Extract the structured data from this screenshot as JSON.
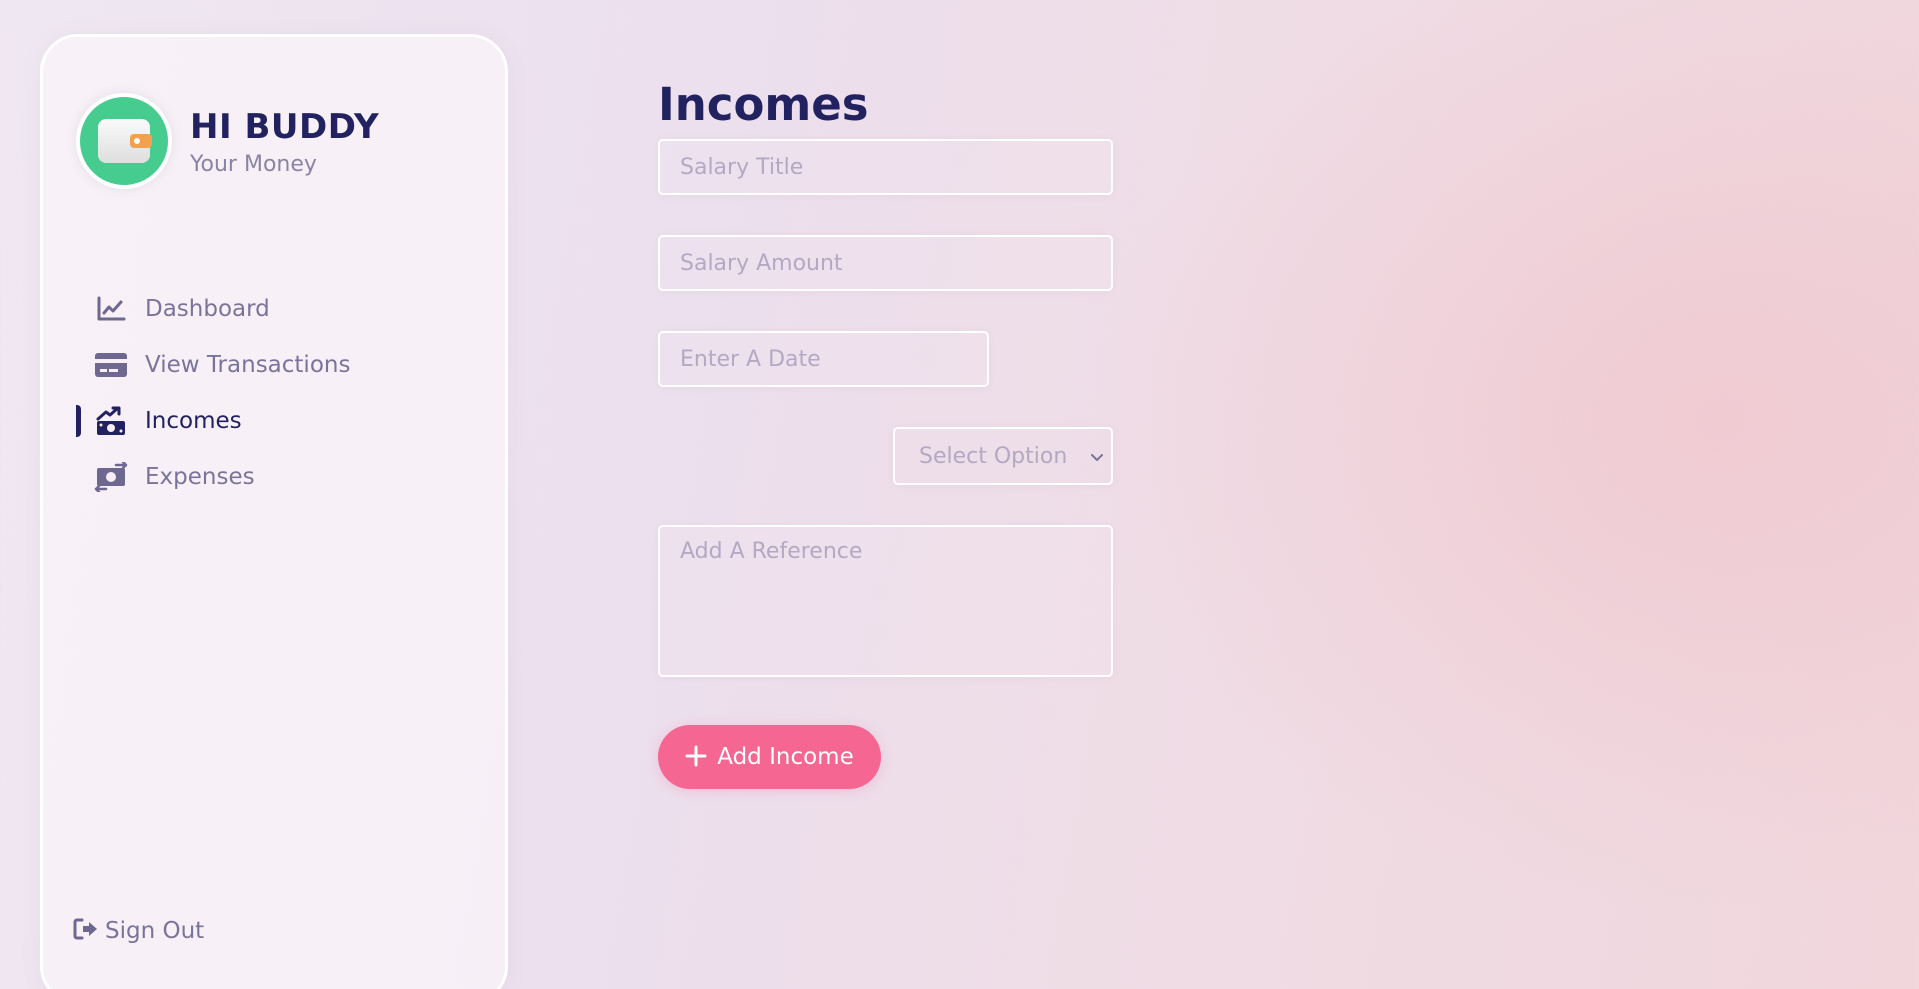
{
  "brand": {
    "title": "HI BUDDY",
    "tagline": "Your Money"
  },
  "nav": {
    "items": [
      {
        "label": "Dashboard",
        "icon": "chart-line-icon",
        "active": false
      },
      {
        "label": "View Transactions",
        "icon": "credit-card-icon",
        "active": false
      },
      {
        "label": "Incomes",
        "icon": "money-bill-trend-up-icon",
        "active": true
      },
      {
        "label": "Expenses",
        "icon": "money-bill-transfer-icon",
        "active": false
      }
    ],
    "signout": {
      "label": "Sign Out",
      "icon": "sign-out-icon"
    }
  },
  "main": {
    "title": "Incomes",
    "form": {
      "title_placeholder": "Salary Title",
      "amount_placeholder": "Salary Amount",
      "date_placeholder": "Enter A Date",
      "category_selected": "Select Option",
      "reference_placeholder": "Add A Reference",
      "submit_label": "Add Income",
      "submit_icon": "plus-icon"
    }
  },
  "colors": {
    "primary_text": "#222260",
    "muted_text": "#7a7498",
    "placeholder": "#b3a9c3",
    "accent": "#f56692",
    "avatar_bg": "#45cc8e"
  }
}
